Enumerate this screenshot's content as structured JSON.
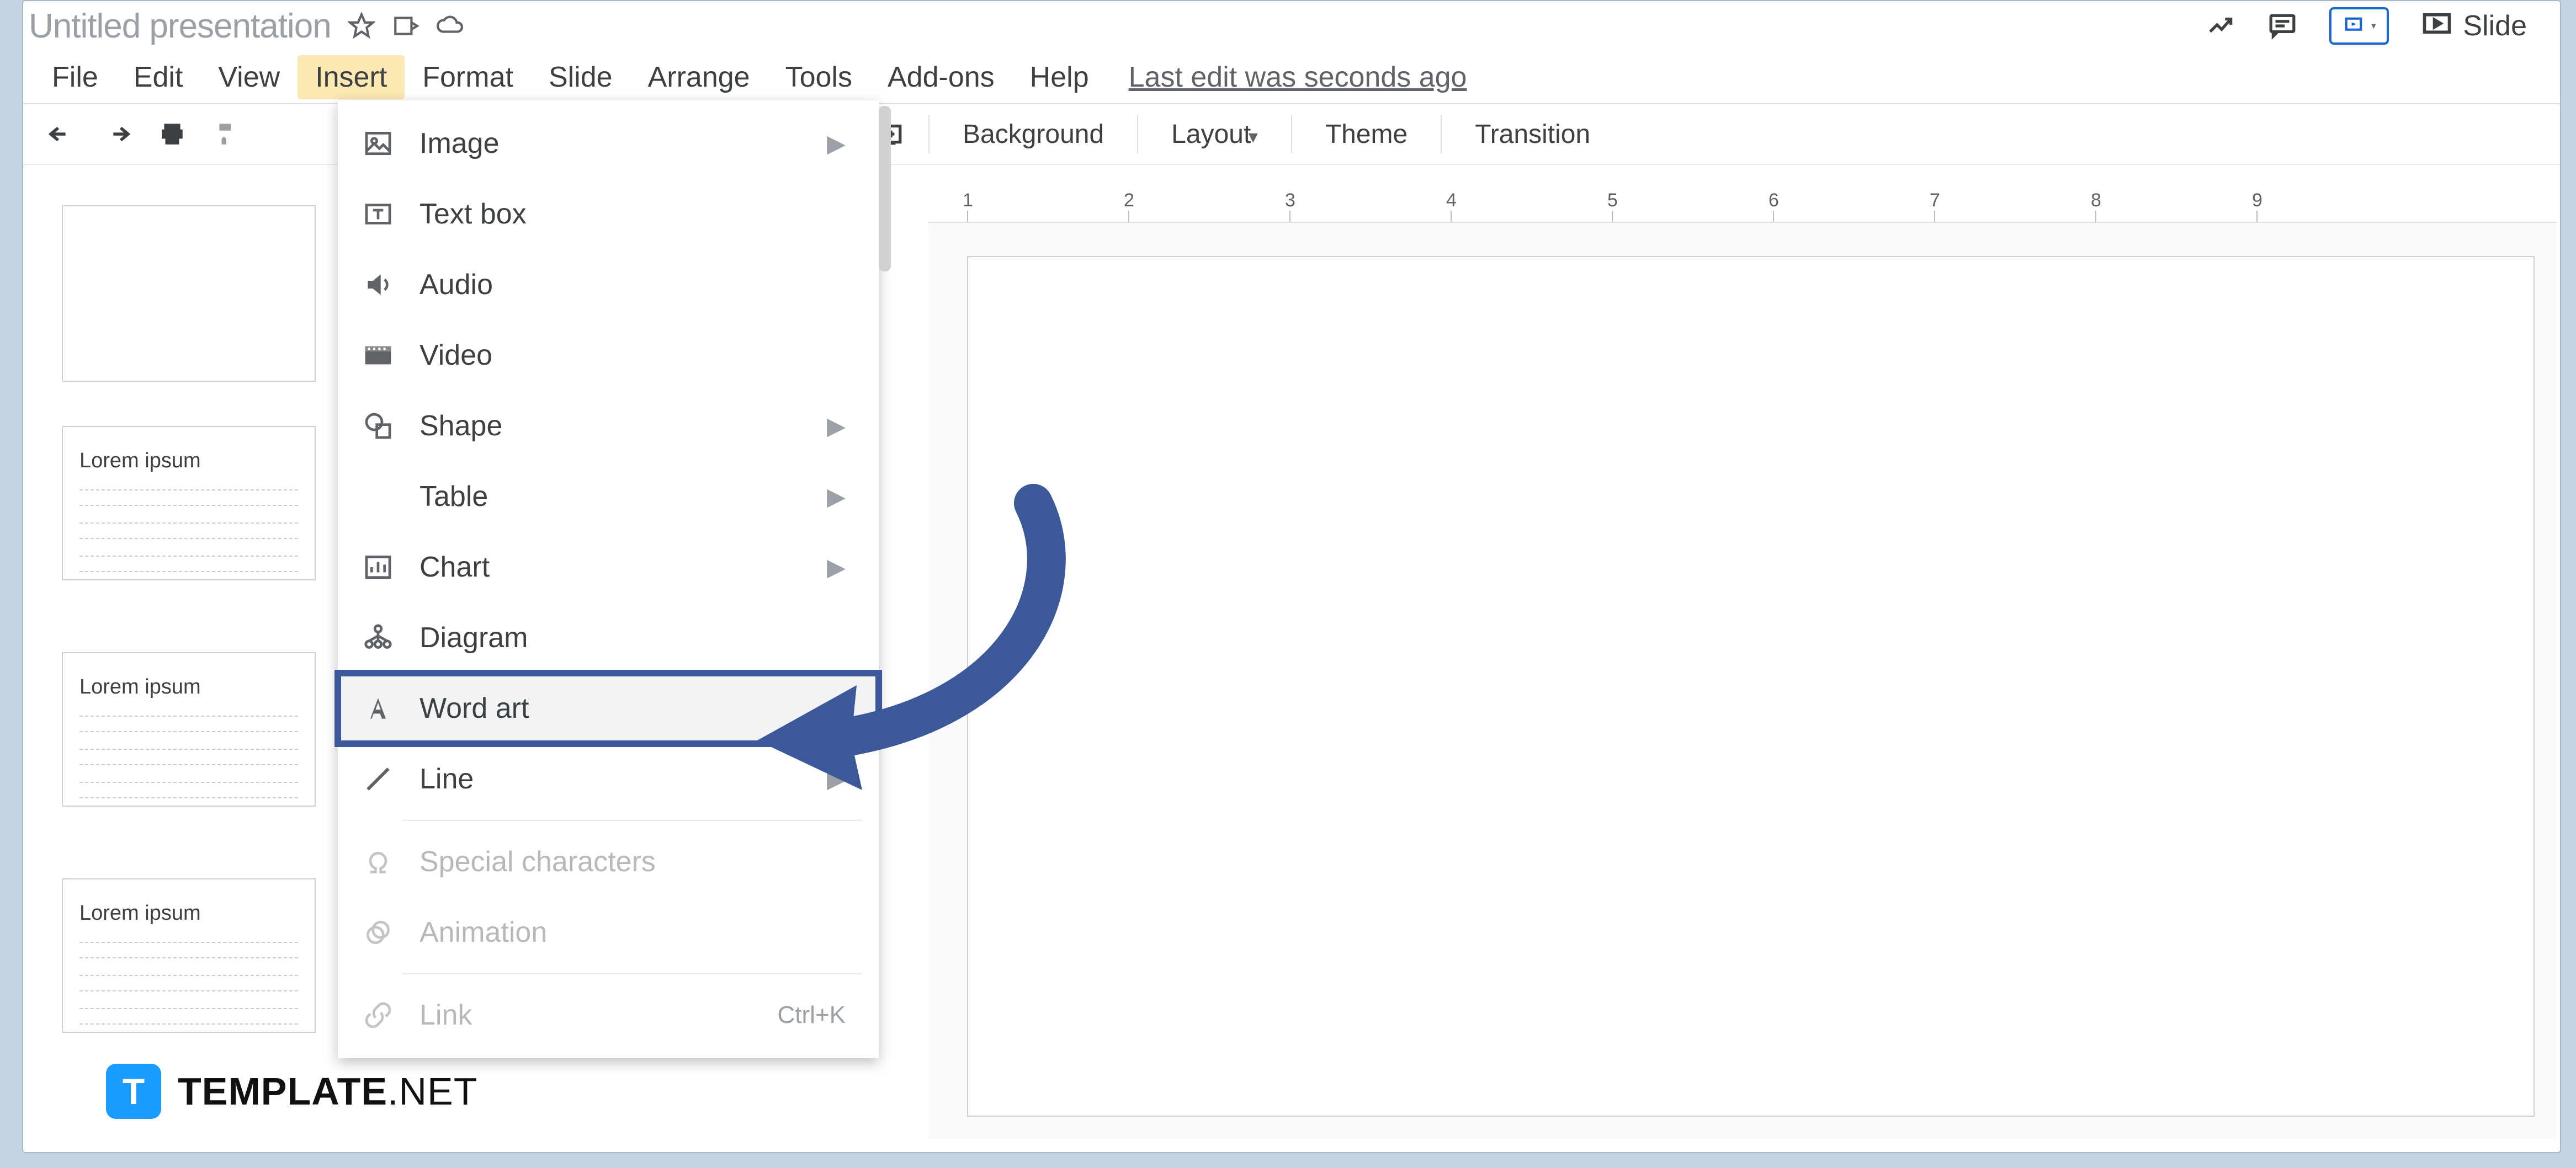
{
  "doc_title": "Untitled presentation",
  "menubar": {
    "file": "File",
    "edit": "Edit",
    "view": "View",
    "insert": "Insert",
    "format": "Format",
    "slide": "Slide",
    "arrange": "Arrange",
    "tools": "Tools",
    "addons": "Add-ons",
    "help": "Help"
  },
  "last_edit": "Last edit was seconds ago",
  "toolbar": {
    "background": "Background",
    "layout": "Layout",
    "theme": "Theme",
    "transition": "Transition"
  },
  "slideshow_label": "Slide",
  "dropdown": {
    "image": "Image",
    "textbox": "Text box",
    "audio": "Audio",
    "video": "Video",
    "shape": "Shape",
    "table": "Table",
    "chart": "Chart",
    "diagram": "Diagram",
    "wordart": "Word art",
    "line": "Line",
    "special": "Special characters",
    "animation": "Animation",
    "link": "Link",
    "link_shortcut": "Ctrl+K"
  },
  "thumbs": {
    "label": "Lorem ipsum"
  },
  "ruler": {
    "ticks": [
      "1",
      "2",
      "3",
      "4",
      "5",
      "6",
      "7",
      "8",
      "9"
    ]
  },
  "watermark": {
    "badge": "T",
    "brand": "TEMPLATE",
    "ext": ".NET"
  }
}
